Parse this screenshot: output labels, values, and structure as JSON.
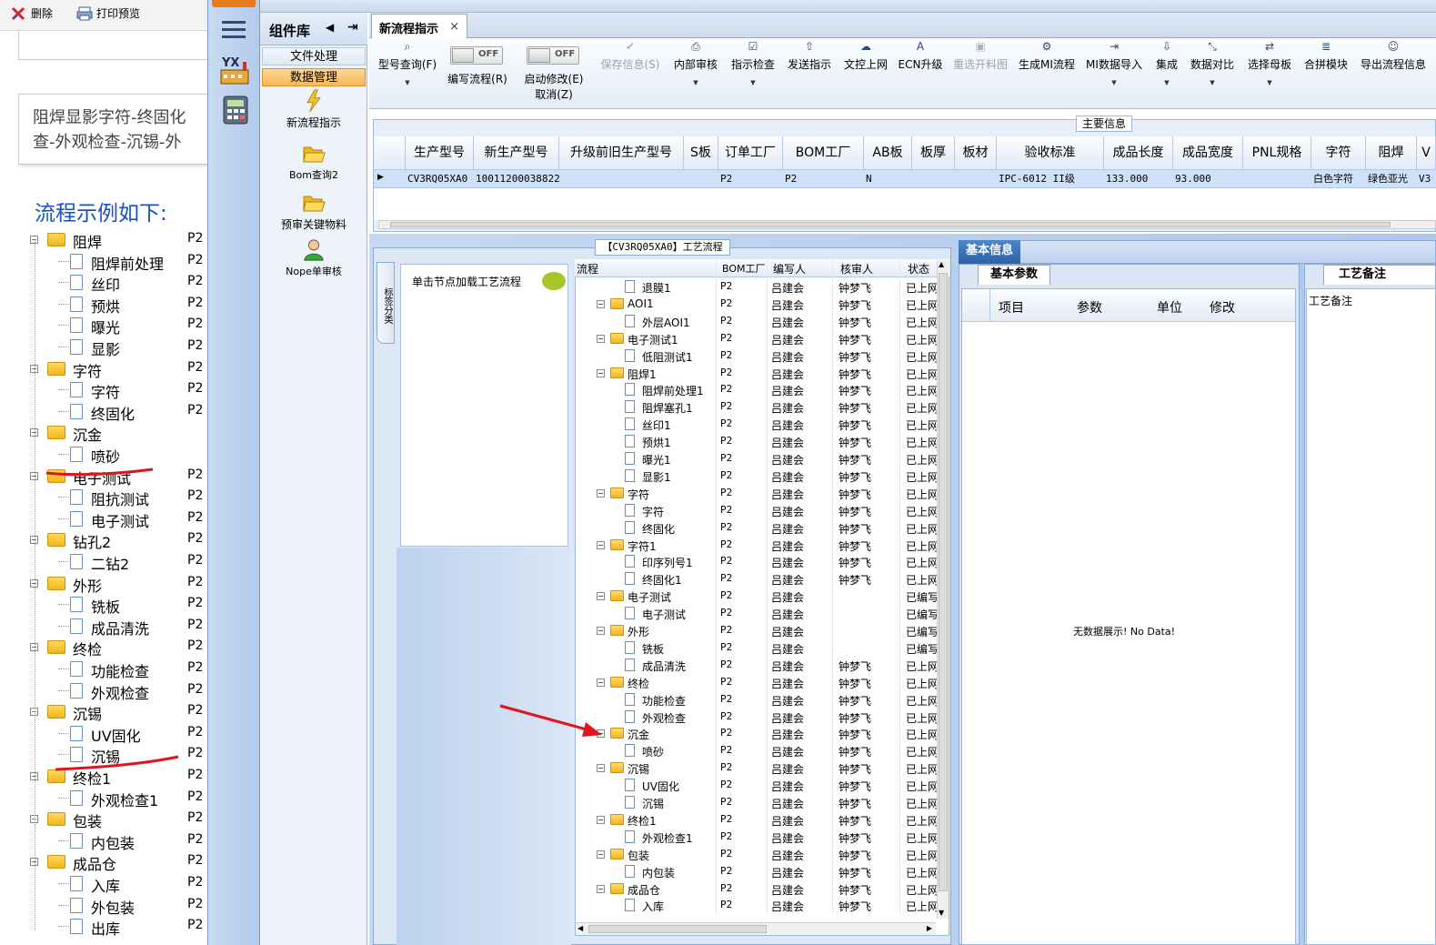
{
  "left_doc": {
    "toolbar": {
      "delete": "删除",
      "print_preview": "打印预览"
    },
    "paragraph": [
      "阻焊显影字符-终固化",
      "查-外观检查-沉锡-外"
    ],
    "example_title": "流程示例如下:",
    "tree": [
      {
        "label": "阻焊",
        "level": 0,
        "code": "P2"
      },
      {
        "label": "阻焊前处理",
        "level": 1,
        "code": "P2"
      },
      {
        "label": "丝印",
        "level": 1,
        "code": "P2"
      },
      {
        "label": "预烘",
        "level": 1,
        "code": "P2"
      },
      {
        "label": "曝光",
        "level": 1,
        "code": "P2"
      },
      {
        "label": "显影",
        "level": 1,
        "code": "P2"
      },
      {
        "label": "字符",
        "level": 0,
        "code": "P2"
      },
      {
        "label": "字符",
        "level": 1,
        "code": "P2"
      },
      {
        "label": "终固化",
        "level": 1,
        "code": "P2"
      },
      {
        "label": "沉金",
        "level": 0,
        "code": ""
      },
      {
        "label": "喷砂",
        "level": 1,
        "code": ""
      },
      {
        "label": "电子测试",
        "level": 0,
        "code": "P2"
      },
      {
        "label": "阻抗测试",
        "level": 1,
        "code": "P2"
      },
      {
        "label": "电子测试",
        "level": 1,
        "code": "P2"
      },
      {
        "label": "钻孔2",
        "level": 0,
        "code": "P2"
      },
      {
        "label": "二钻2",
        "level": 1,
        "code": "P2"
      },
      {
        "label": "外形",
        "level": 0,
        "code": "P2"
      },
      {
        "label": "铣板",
        "level": 1,
        "code": "P2"
      },
      {
        "label": "成品清洗",
        "level": 1,
        "code": "P2"
      },
      {
        "label": "终检",
        "level": 0,
        "code": "P2"
      },
      {
        "label": "功能检查",
        "level": 1,
        "code": "P2"
      },
      {
        "label": "外观检查",
        "level": 1,
        "code": "P2"
      },
      {
        "label": "沉锡",
        "level": 0,
        "code": "P2"
      },
      {
        "label": "UV固化",
        "level": 1,
        "code": "P2"
      },
      {
        "label": "沉锡",
        "level": 1,
        "code": "P2"
      },
      {
        "label": "终检1",
        "level": 0,
        "code": "P2"
      },
      {
        "label": "外观检查1",
        "level": 1,
        "code": "P2"
      },
      {
        "label": "包装",
        "level": 0,
        "code": "P2"
      },
      {
        "label": "内包装",
        "level": 1,
        "code": "P2"
      },
      {
        "label": "成品仓",
        "level": 0,
        "code": "P2"
      },
      {
        "label": "入库",
        "level": 1,
        "code": "P2"
      },
      {
        "label": "外包装",
        "level": 1,
        "code": "P2"
      },
      {
        "label": "出库",
        "level": 1,
        "code": "P2"
      }
    ]
  },
  "sidebar": {
    "app_badge": "YX"
  },
  "component_library": {
    "title": "组件库",
    "groups": [
      "文件处理",
      "数据管理"
    ],
    "items": [
      "新流程指示",
      "Bom查询2",
      "预审关键物料",
      "Nope单审核"
    ]
  },
  "tabs": [
    {
      "label": "新流程指示",
      "close": "×"
    }
  ],
  "ribbon": [
    {
      "label": "型号查询(F)",
      "icon": "search-icon",
      "caret": true,
      "disabled": false
    },
    {
      "label": "编写流程(R)",
      "icon": "toggle",
      "toggle": "OFF",
      "caret": false,
      "disabled": false
    },
    {
      "label": "启动修改(E)",
      "label2": "取消(Z)",
      "icon": "toggle",
      "toggle": "OFF",
      "caret": false,
      "disabled": false
    },
    {
      "label": "保存信息(S)",
      "icon": "check-icon",
      "caret": false,
      "disabled": true
    },
    {
      "label": "内部审核",
      "icon": "printer-icon",
      "caret": true,
      "disabled": false
    },
    {
      "label": "指示检查",
      "icon": "checkbox-icon",
      "caret": true,
      "disabled": false
    },
    {
      "label": "发送指示",
      "icon": "upload-icon",
      "caret": false,
      "disabled": false
    },
    {
      "label": "文控上网",
      "icon": "cloud-upload-icon",
      "caret": false,
      "disabled": false
    },
    {
      "label": "ECN升级",
      "icon": "ecn-icon",
      "caret": false,
      "disabled": false
    },
    {
      "label": "重选开料图",
      "icon": "image-icon",
      "caret": false,
      "disabled": true
    },
    {
      "label": "生成MI流程",
      "icon": "cogs-icon",
      "caret": false,
      "disabled": false
    },
    {
      "label": "MI数据导入",
      "icon": "import-icon",
      "caret": true,
      "disabled": false
    },
    {
      "label": "集成",
      "icon": "download-icon",
      "caret": true,
      "disabled": false
    },
    {
      "label": "数据对比",
      "icon": "compress-icon",
      "caret": true,
      "disabled": false
    },
    {
      "label": "选择母板",
      "icon": "shuffle-icon",
      "caret": true,
      "disabled": false
    },
    {
      "label": "合拼模块",
      "icon": "list-icon",
      "caret": false,
      "disabled": false
    },
    {
      "label": "导出流程信息",
      "icon": "smile-icon",
      "caret": false,
      "disabled": false
    }
  ],
  "main_info": {
    "title": "主要信息",
    "columns": [
      "生产型号",
      "新生产型号",
      "升级前旧生产型号",
      "S板",
      "订单工厂",
      "BOM工厂",
      "AB板",
      "板厚",
      "板材",
      "验收标准",
      "成品长度",
      "成品宽度",
      "PNL规格",
      "字符",
      "阻焊",
      "V"
    ],
    "row": [
      "CV3RQ05XA0",
      "10011200038822",
      "",
      "",
      "P2",
      "P2",
      "N",
      "",
      "",
      "IPC-6012 II级",
      "133.000",
      "93.000",
      "",
      "白色字符",
      "绿色亚光",
      "V3"
    ]
  },
  "flow_panel": {
    "title": "【CV3RQ05XA0】工艺流程",
    "side_tab": "标签分类",
    "hint": "单击节点加载工艺流程",
    "columns": [
      "流程",
      "BOM工厂",
      "编写人",
      "核审人",
      "状态"
    ],
    "rows": [
      {
        "name": "退膜1",
        "level": 1,
        "factory": "P2",
        "writer": "吕建会",
        "reviewer": "钟梦飞",
        "status": "已上网"
      },
      {
        "name": "AOI1",
        "level": 0,
        "factory": "P2",
        "writer": "吕建会",
        "reviewer": "钟梦飞",
        "status": "已上网"
      },
      {
        "name": "外层AOI1",
        "level": 1,
        "factory": "P2",
        "writer": "吕建会",
        "reviewer": "钟梦飞",
        "status": "已上网"
      },
      {
        "name": "电子测试1",
        "level": 0,
        "factory": "P2",
        "writer": "吕建会",
        "reviewer": "钟梦飞",
        "status": "已上网"
      },
      {
        "name": "低阻测试1",
        "level": 1,
        "factory": "P2",
        "writer": "吕建会",
        "reviewer": "钟梦飞",
        "status": "已上网"
      },
      {
        "name": "阻焊1",
        "level": 0,
        "factory": "P2",
        "writer": "吕建会",
        "reviewer": "钟梦飞",
        "status": "已上网"
      },
      {
        "name": "阻焊前处理1",
        "level": 1,
        "factory": "P2",
        "writer": "吕建会",
        "reviewer": "钟梦飞",
        "status": "已上网"
      },
      {
        "name": "阻焊塞孔1",
        "level": 1,
        "factory": "P2",
        "writer": "吕建会",
        "reviewer": "钟梦飞",
        "status": "已上网"
      },
      {
        "name": "丝印1",
        "level": 1,
        "factory": "P2",
        "writer": "吕建会",
        "reviewer": "钟梦飞",
        "status": "已上网"
      },
      {
        "name": "预烘1",
        "level": 1,
        "factory": "P2",
        "writer": "吕建会",
        "reviewer": "钟梦飞",
        "status": "已上网"
      },
      {
        "name": "曝光1",
        "level": 1,
        "factory": "P2",
        "writer": "吕建会",
        "reviewer": "钟梦飞",
        "status": "已上网"
      },
      {
        "name": "显影1",
        "level": 1,
        "factory": "P2",
        "writer": "吕建会",
        "reviewer": "钟梦飞",
        "status": "已上网"
      },
      {
        "name": "字符",
        "level": 0,
        "factory": "P2",
        "writer": "吕建会",
        "reviewer": "钟梦飞",
        "status": "已上网"
      },
      {
        "name": "字符",
        "level": 1,
        "factory": "P2",
        "writer": "吕建会",
        "reviewer": "钟梦飞",
        "status": "已上网"
      },
      {
        "name": "终固化",
        "level": 1,
        "factory": "P2",
        "writer": "吕建会",
        "reviewer": "钟梦飞",
        "status": "已上网"
      },
      {
        "name": "字符1",
        "level": 0,
        "factory": "P2",
        "writer": "吕建会",
        "reviewer": "钟梦飞",
        "status": "已上网"
      },
      {
        "name": "印序列号1",
        "level": 1,
        "factory": "P2",
        "writer": "吕建会",
        "reviewer": "钟梦飞",
        "status": "已上网"
      },
      {
        "name": "终固化1",
        "level": 1,
        "factory": "P2",
        "writer": "吕建会",
        "reviewer": "钟梦飞",
        "status": "已上网"
      },
      {
        "name": "电子测试",
        "level": 0,
        "factory": "P2",
        "writer": "吕建会",
        "reviewer": "",
        "status": "已编写"
      },
      {
        "name": "电子测试",
        "level": 1,
        "factory": "P2",
        "writer": "吕建会",
        "reviewer": "",
        "status": "已编写"
      },
      {
        "name": "外形",
        "level": 0,
        "factory": "P2",
        "writer": "吕建会",
        "reviewer": "",
        "status": "已编写"
      },
      {
        "name": "铣板",
        "level": 1,
        "factory": "P2",
        "writer": "吕建会",
        "reviewer": "",
        "status": "已编写"
      },
      {
        "name": "成品清洗",
        "level": 1,
        "factory": "P2",
        "writer": "吕建会",
        "reviewer": "钟梦飞",
        "status": "已上网"
      },
      {
        "name": "终检",
        "level": 0,
        "factory": "P2",
        "writer": "吕建会",
        "reviewer": "钟梦飞",
        "status": "已上网"
      },
      {
        "name": "功能检查",
        "level": 1,
        "factory": "P2",
        "writer": "吕建会",
        "reviewer": "钟梦飞",
        "status": "已上网"
      },
      {
        "name": "外观检查",
        "level": 1,
        "factory": "P2",
        "writer": "吕建会",
        "reviewer": "钟梦飞",
        "status": "已上网"
      },
      {
        "name": "沉金",
        "level": 0,
        "factory": "P2",
        "writer": "吕建会",
        "reviewer": "钟梦飞",
        "status": "已上网"
      },
      {
        "name": "喷砂",
        "level": 1,
        "factory": "P2",
        "writer": "吕建会",
        "reviewer": "钟梦飞",
        "status": "已上网"
      },
      {
        "name": "沉锡",
        "level": 0,
        "factory": "P2",
        "writer": "吕建会",
        "reviewer": "钟梦飞",
        "status": "已上网"
      },
      {
        "name": "UV固化",
        "level": 1,
        "factory": "P2",
        "writer": "吕建会",
        "reviewer": "钟梦飞",
        "status": "已上网"
      },
      {
        "name": "沉锡",
        "level": 1,
        "factory": "P2",
        "writer": "吕建会",
        "reviewer": "钟梦飞",
        "status": "已上网"
      },
      {
        "name": "终检1",
        "level": 0,
        "factory": "P2",
        "writer": "吕建会",
        "reviewer": "钟梦飞",
        "status": "已上网"
      },
      {
        "name": "外观检查1",
        "level": 1,
        "factory": "P2",
        "writer": "吕建会",
        "reviewer": "钟梦飞",
        "status": "已上网"
      },
      {
        "name": "包装",
        "level": 0,
        "factory": "P2",
        "writer": "吕建会",
        "reviewer": "钟梦飞",
        "status": "已上网"
      },
      {
        "name": "内包装",
        "level": 1,
        "factory": "P2",
        "writer": "吕建会",
        "reviewer": "钟梦飞",
        "status": "已上网"
      },
      {
        "name": "成品仓",
        "level": 0,
        "factory": "P2",
        "writer": "吕建会",
        "reviewer": "钟梦飞",
        "status": "已上网"
      },
      {
        "name": "入库",
        "level": 1,
        "factory": "P2",
        "writer": "吕建会",
        "reviewer": "钟梦飞",
        "status": "已上网"
      }
    ]
  },
  "basic_info": {
    "tab": "基本信息",
    "params_tab": "基本参数",
    "columns": [
      "项目",
      "参数",
      "单位",
      "修改"
    ],
    "empty": "无数据展示! No Data!",
    "notes_tab": "工艺备注",
    "notes_label": "工艺备注"
  },
  "colors": {
    "accent": "#2c62a8",
    "annotation": "#e0141c",
    "link_blue": "#1a4fc9"
  }
}
